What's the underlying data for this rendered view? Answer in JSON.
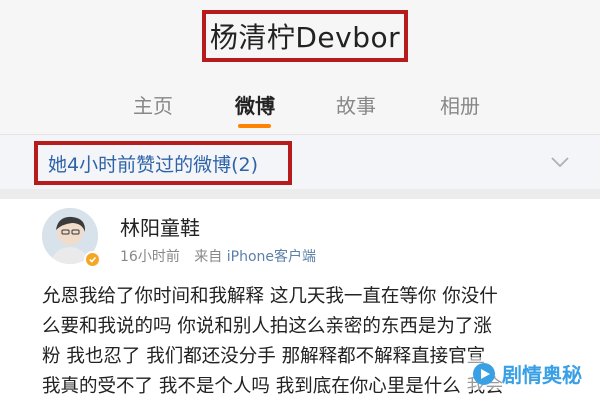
{
  "profile": {
    "title": "杨清柠Devbor"
  },
  "tabs": [
    {
      "label": "主页",
      "active": false
    },
    {
      "label": "微博",
      "active": true
    },
    {
      "label": "故事",
      "active": false
    },
    {
      "label": "相册",
      "active": false
    }
  ],
  "notice": {
    "text": "她4小时前赞过的微博(2)"
  },
  "post": {
    "author": "林阳童鞋",
    "time": "16小时前",
    "from_label": "来自",
    "source": "iPhone客户端",
    "lines": [
      "允恩我给了你时间和我解释 这几天我一直在等你 你没什",
      "么要和我说的吗 你说和别人拍这么亲密的东西是为了涨",
      "粉 我也忍了 我们都还没分手 那解释都不解释直接官宣",
      "我真的受不了 我不是个人吗 我到底在你心里是什么 我会"
    ]
  },
  "watermark": {
    "text": "剧情奥秘"
  },
  "colors": {
    "highlight_border": "#b71c1c",
    "tab_accent": "#ff8200",
    "link_blue": "#2f63a8",
    "verified_badge": "#f5a623"
  }
}
